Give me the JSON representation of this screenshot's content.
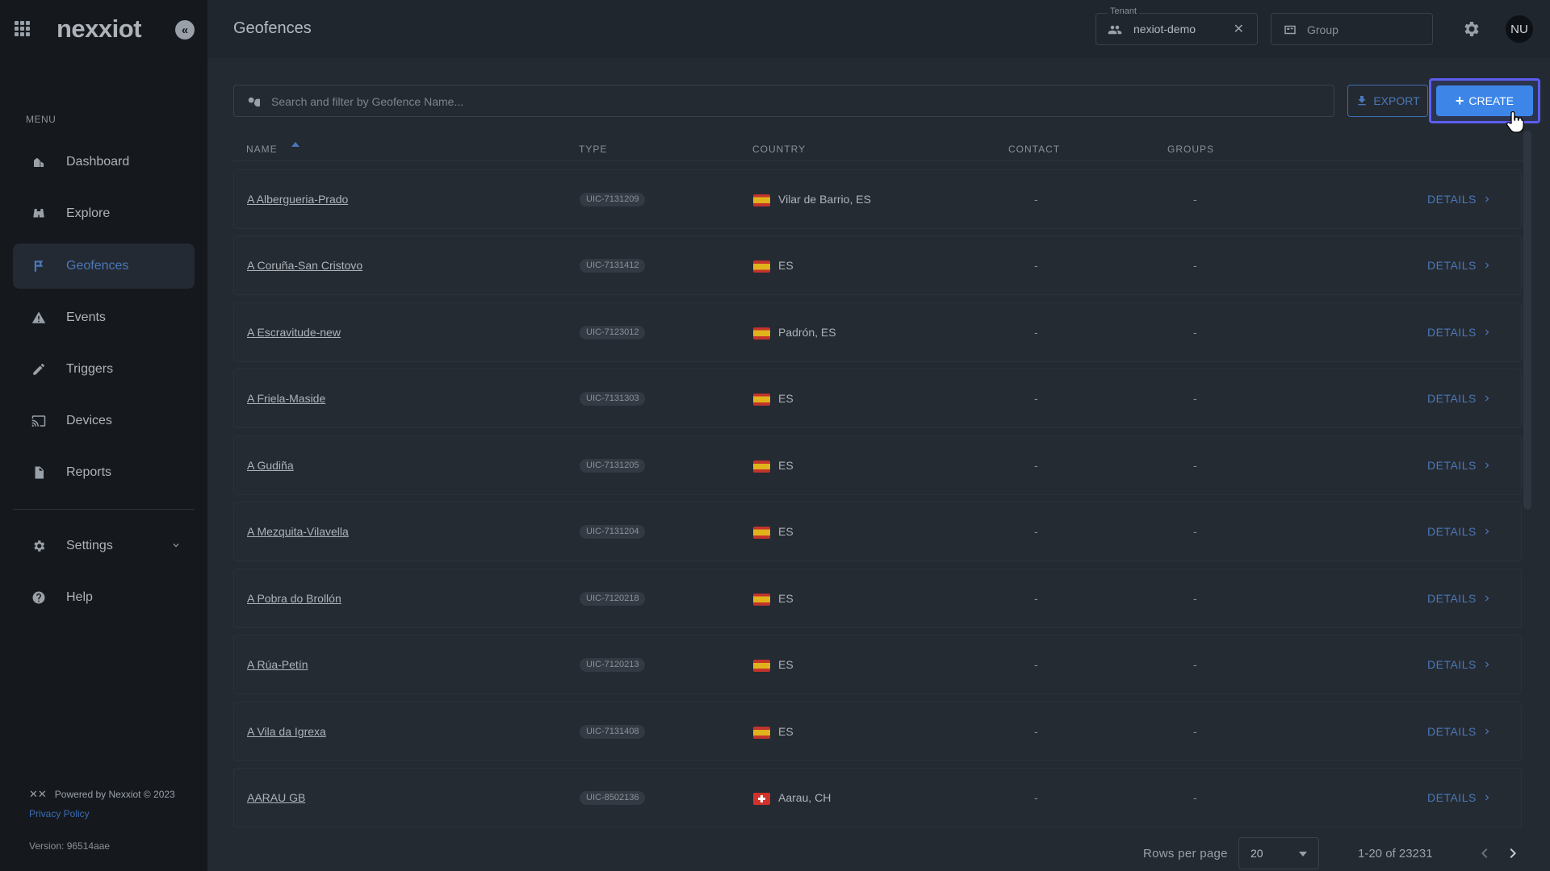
{
  "sidebar": {
    "logo": "nexxiot",
    "menu_label": "MENU",
    "items": [
      {
        "label": "Dashboard",
        "icon": "dashboard-icon"
      },
      {
        "label": "Explore",
        "icon": "binoculars-icon"
      },
      {
        "label": "Geofences",
        "icon": "geofence-flag-icon",
        "active": true
      },
      {
        "label": "Events",
        "icon": "warning-icon"
      },
      {
        "label": "Triggers",
        "icon": "pencil-icon"
      },
      {
        "label": "Devices",
        "icon": "cast-icon"
      },
      {
        "label": "Reports",
        "icon": "document-icon"
      },
      {
        "label": "Settings",
        "icon": "gear-icon"
      },
      {
        "label": "Help",
        "icon": "help-icon"
      }
    ],
    "footer": {
      "powered_by": "Powered by Nexxiot © 2023",
      "privacy_policy": "Privacy Policy",
      "version": "Version: 96514aae"
    }
  },
  "header": {
    "title": "Geofences",
    "tenant": {
      "legend": "Tenant",
      "value": "nexiot-demo",
      "clear": "✕"
    },
    "group": {
      "placeholder": "Group"
    },
    "avatar_initials": "NU"
  },
  "toolbar": {
    "search_placeholder": "Search and filter by Geofence Name...",
    "export_label": "EXPORT",
    "create_label": "CREATE"
  },
  "table": {
    "columns": {
      "name": "NAME",
      "type": "TYPE",
      "country": "COUNTRY",
      "contact": "CONTACT",
      "groups": "GROUPS"
    },
    "details_label": "DETAILS",
    "rows": [
      {
        "name": "A Albergueria-Prado",
        "type": "UIC-7131209",
        "flag": "es",
        "country": "Vilar de Barrio, ES",
        "contact": "-",
        "groups": "-"
      },
      {
        "name": "A Coruña-San Cristovo",
        "type": "UIC-7131412",
        "flag": "es",
        "country": "ES",
        "contact": "-",
        "groups": "-"
      },
      {
        "name": "A Escravitude-new",
        "type": "UIC-7123012",
        "flag": "es",
        "country": "Padrón, ES",
        "contact": "-",
        "groups": "-"
      },
      {
        "name": "A Friela-Maside",
        "type": "UIC-7131303",
        "flag": "es",
        "country": "ES",
        "contact": "-",
        "groups": "-"
      },
      {
        "name": "A Gudiña",
        "type": "UIC-7131205",
        "flag": "es",
        "country": "ES",
        "contact": "-",
        "groups": "-"
      },
      {
        "name": "A Mezquita-Vilavella",
        "type": "UIC-7131204",
        "flag": "es",
        "country": "ES",
        "contact": "-",
        "groups": "-"
      },
      {
        "name": "A Pobra do Brollón",
        "type": "UIC-7120218",
        "flag": "es",
        "country": "ES",
        "contact": "-",
        "groups": "-"
      },
      {
        "name": "A Rúa-Petín",
        "type": "UIC-7120213",
        "flag": "es",
        "country": "ES",
        "contact": "-",
        "groups": "-"
      },
      {
        "name": "A Vila da Igrexa",
        "type": "UIC-7131408",
        "flag": "es",
        "country": "ES",
        "contact": "-",
        "groups": "-"
      },
      {
        "name": "AARAU GB",
        "type": "UIC-8502136",
        "flag": "ch",
        "country": "Aarau, CH",
        "contact": "-",
        "groups": "-"
      }
    ]
  },
  "pagination": {
    "rows_per_page_label": "Rows per page",
    "rows_per_page": "20",
    "range": "1-20 of 23231"
  },
  "colors": {
    "accent": "#4a78b8",
    "create_button": "#3d86e8",
    "highlight_border": "#5b5cf0"
  }
}
